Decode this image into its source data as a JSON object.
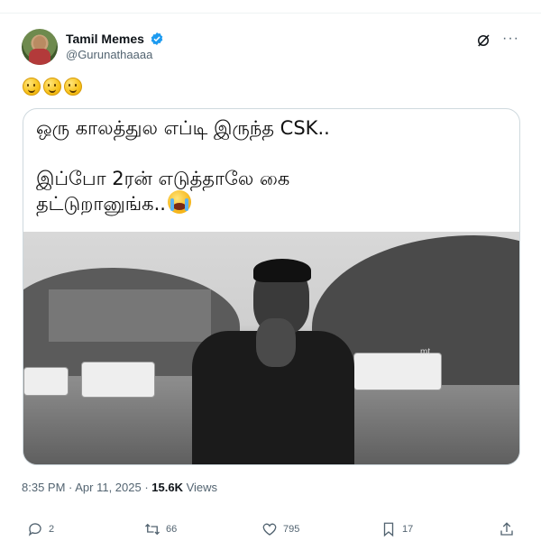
{
  "user": {
    "display_name": "Tamil Memes",
    "handle": "@Gurunathaaaa"
  },
  "tweet": {
    "emoji_text": "🙂🙂🙂",
    "meme_line1": "ஒரு காலத்துல எப்டி இருந்த CSK..",
    "meme_line2": "இப்போ 2ரன் எடுத்தாலே கை",
    "meme_line3": "தட்டுறானுங்க..",
    "watermark": "mt",
    "timestamp": "8:35 PM · Apr 11, 2025 · ",
    "views_count": "15.6K",
    "views_label": " Views"
  },
  "actions": {
    "replies": "2",
    "retweets": "66",
    "likes": "795",
    "bookmarks": "17"
  },
  "icons": {
    "verified": "verified-badge-icon",
    "grok": "grok-icon",
    "more": "more-icon",
    "reply": "reply-icon",
    "retweet": "retweet-icon",
    "like": "heart-icon",
    "bookmark": "bookmark-icon",
    "share": "share-icon"
  },
  "colors": {
    "verified": "#1d9bf0",
    "secondary_text": "#536471",
    "border": "#cfd9de"
  }
}
